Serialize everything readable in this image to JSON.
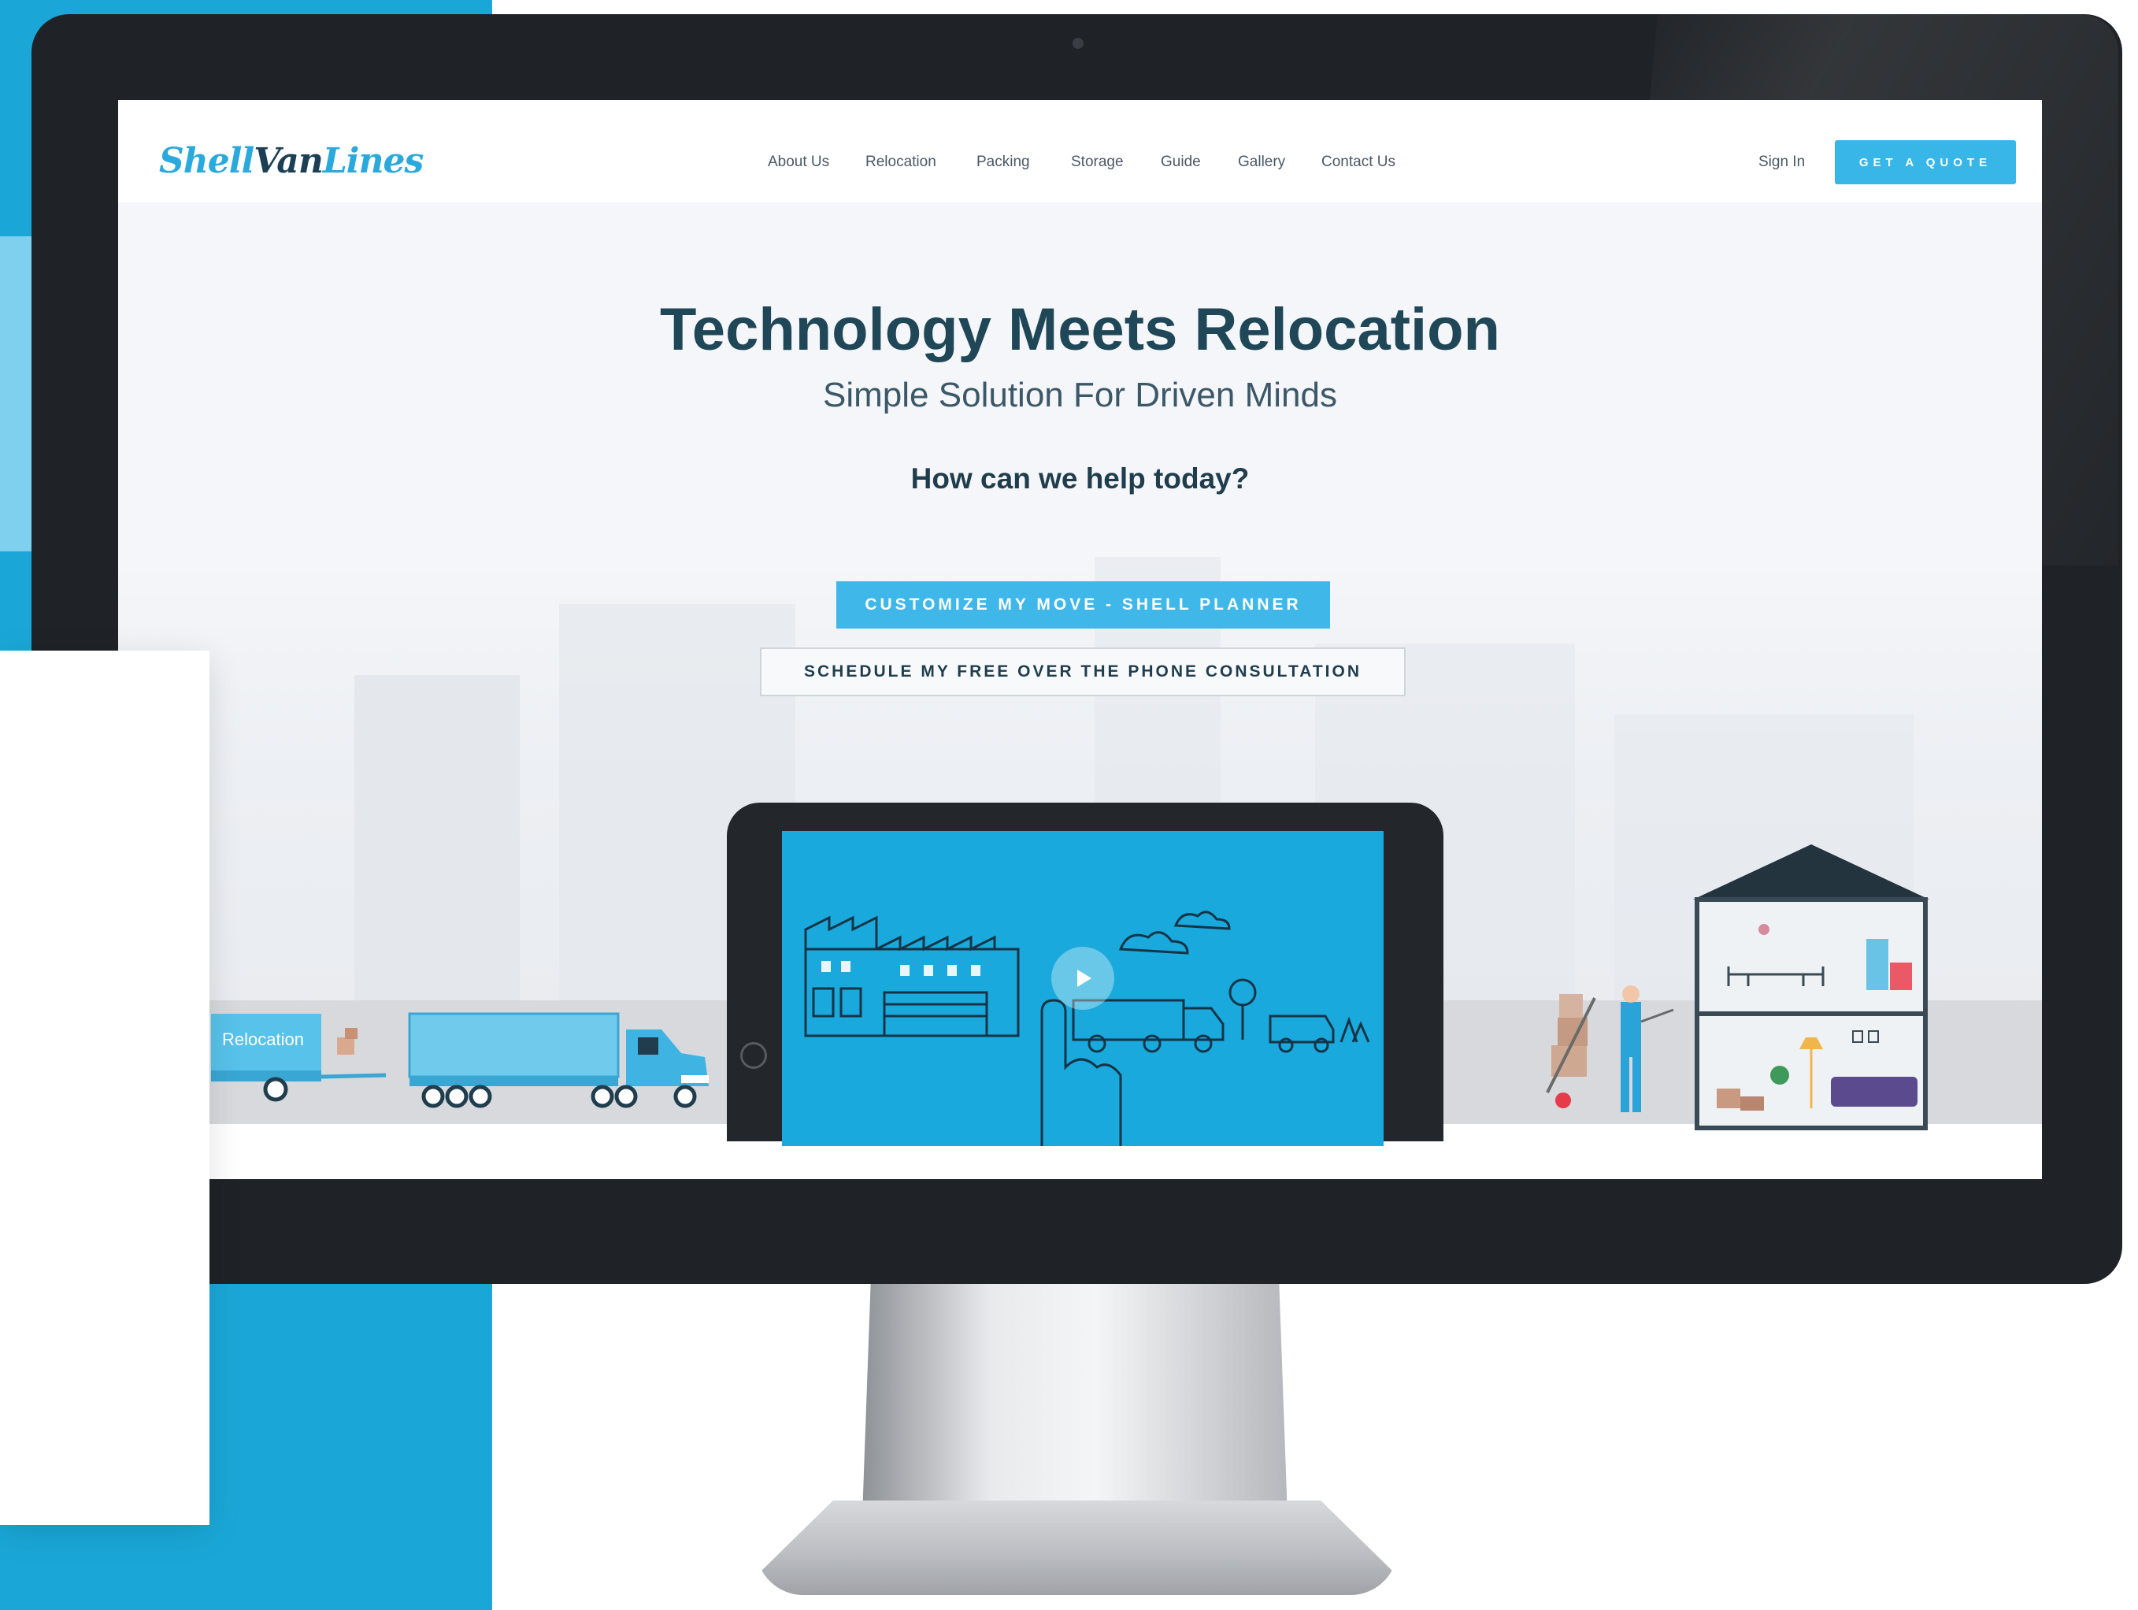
{
  "site": {
    "logo": {
      "part1": "Shell",
      "part2": "Van",
      "part3": "Lines"
    },
    "nav": [
      "About Us",
      "Relocation",
      "Packing",
      "Storage",
      "Guide",
      "Gallery",
      "Contact Us"
    ],
    "sign_in": "Sign In",
    "quote_button": "GET A QUOTE"
  },
  "hero": {
    "title": "Technology Meets Relocation",
    "subtitle": "Simple Solution For Driven Minds",
    "question": "How can we help today?",
    "primary_button": "CUSTOMIZE MY MOVE - SHELL PLANNER",
    "secondary_button": "SCHEDULE MY FREE OVER THE PHONE CONSULTATION"
  },
  "illustration": {
    "truck_label": "Relocation"
  },
  "colors": {
    "accent": "#38b6e8",
    "dark_text": "#1f4758",
    "bezel": "#1f2226",
    "bg_blue": "#1aa7d8"
  }
}
